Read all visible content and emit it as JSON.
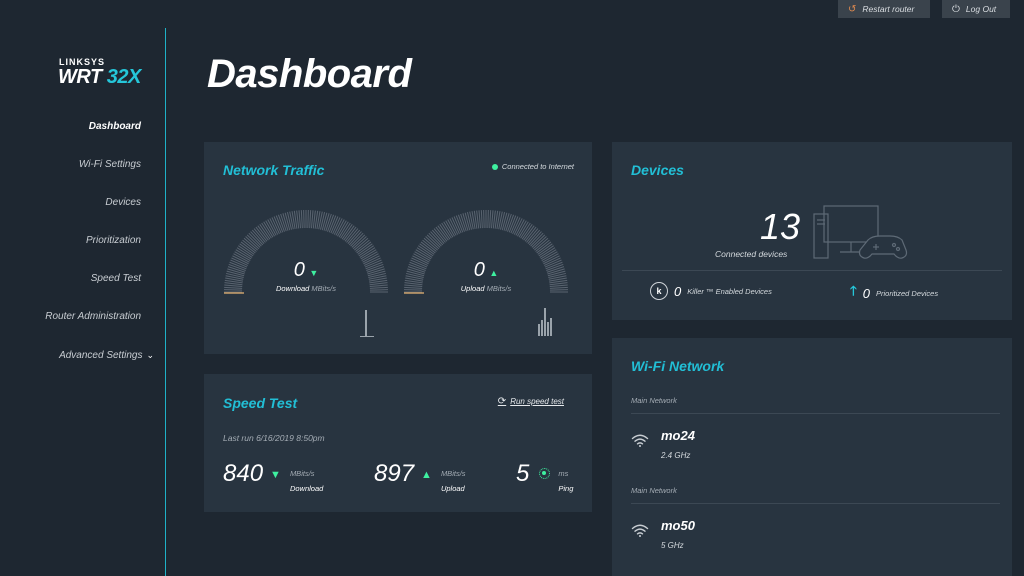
{
  "top_bar": {
    "restart_label": "Restart router",
    "logout_label": "Log Out"
  },
  "logo": {
    "brand": "LINKSYS",
    "model_prefix": "WRT",
    "model_suffix": "32X"
  },
  "sidebar": {
    "items": [
      {
        "label": "Dashboard",
        "active": true
      },
      {
        "label": "Wi-Fi Settings"
      },
      {
        "label": "Devices"
      },
      {
        "label": "Prioritization"
      },
      {
        "label": "Speed Test"
      },
      {
        "label": "Router Administration"
      },
      {
        "label": "Advanced Settings"
      }
    ]
  },
  "page": {
    "title": "Dashboard"
  },
  "network_traffic": {
    "title": "Network Traffic",
    "status": "Connected to Internet",
    "download": {
      "value": "0",
      "label": "Download",
      "unit": "MBits/s"
    },
    "upload": {
      "value": "0",
      "label": "Upload",
      "unit": "MBits/s"
    }
  },
  "speed_test": {
    "title": "Speed Test",
    "run_label": "Run speed test",
    "last_run": "Last run 6/16/2019 8:50pm",
    "download": {
      "value": "840",
      "unit": "MBits/s",
      "label": "Download"
    },
    "upload": {
      "value": "897",
      "unit": "MBits/s",
      "label": "Upload"
    },
    "ping": {
      "value": "5",
      "unit": "ms",
      "label": "Ping"
    }
  },
  "devices": {
    "title": "Devices",
    "count": "13",
    "count_label": "Connected devices",
    "killer": {
      "value": "0",
      "label": "Killer ™ Enabled Devices"
    },
    "prioritized": {
      "value": "0",
      "label": "Prioritized Devices"
    }
  },
  "wifi": {
    "title": "Wi-Fi Network",
    "networks": [
      {
        "header": "Main Network",
        "name": "mo24",
        "band": "2.4 GHz"
      },
      {
        "header": "Main Network",
        "name": "mo50",
        "band": "5 GHz"
      }
    ]
  },
  "colors": {
    "background": "#1e2731",
    "card": "#283440",
    "accent": "#22bfd6",
    "status_green": "#3ef0a0",
    "restart_icon": "#e08a4f"
  },
  "icons": [
    "restart-icon",
    "power-icon",
    "chevron-down-icon",
    "status-dot-icon",
    "arrow-down-icon",
    "arrow-up-icon",
    "refresh-icon",
    "ping-icon",
    "devices-illustration-icon",
    "killer-icon",
    "priority-arrow-icon",
    "wifi-icon"
  ]
}
